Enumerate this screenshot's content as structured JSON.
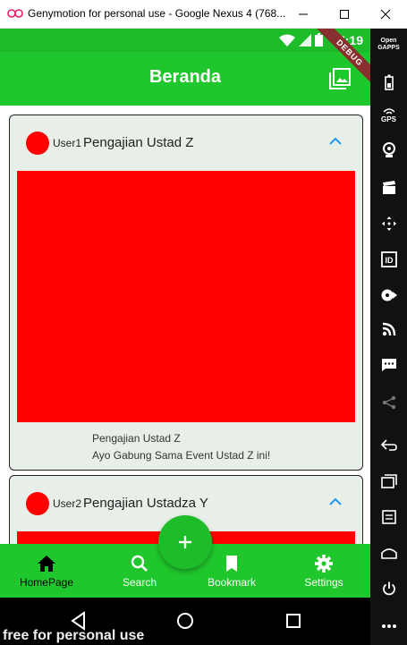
{
  "window": {
    "title": "Genymotion for personal use - Google Nexus 4 (768..."
  },
  "statusbar": {
    "clock": "5:19",
    "debug_ribbon": "DEBUG"
  },
  "appbar": {
    "title": "Beranda"
  },
  "posts": [
    {
      "user": "User1",
      "title": "Pengajian Ustad Z",
      "desc_title": "Pengajian Ustad Z",
      "desc_body": "Ayo Gabung Sama Event Ustad Z ini!"
    },
    {
      "user": "User2",
      "title": "Pengajian Ustadza Y"
    }
  ],
  "bottom_nav": {
    "items": [
      {
        "label": "HomePage",
        "icon": "home-icon",
        "active": true
      },
      {
        "label": "Search",
        "icon": "search-icon"
      },
      {
        "label": "Bookmark",
        "icon": "bookmark-icon"
      },
      {
        "label": "Settings",
        "icon": "settings-icon"
      }
    ],
    "fab_symbol": "+"
  },
  "sidebar": {
    "opengapps_line1": "Open",
    "opengapps_line2": "GAPPS",
    "gps_label": "GPS",
    "id_label": "ID"
  },
  "watermark": "free for personal use",
  "colors": {
    "primary_green": "#1fc72c",
    "status_green": "#1dbd2a",
    "card_bg": "#e8efe9",
    "image_red": "#ff0000",
    "accent_blue": "#2196f3"
  }
}
